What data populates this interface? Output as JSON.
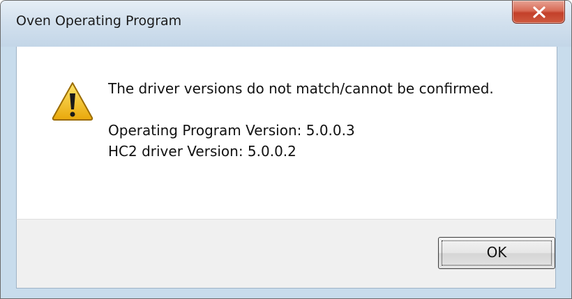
{
  "window": {
    "title": "Oven Operating Program"
  },
  "message": {
    "headline": "The driver versions do not match/cannot be confirmed.",
    "lines": [
      "Operating Program Version: 5.0.0.3",
      "HC2 driver Version: 5.0.0.2"
    ]
  },
  "buttons": {
    "ok_label": "OK",
    "close_icon": "close-icon"
  },
  "icons": {
    "message_icon": "warning-icon"
  },
  "colors": {
    "title_bar": "#c8dcec",
    "close_button": "#cf4f36",
    "warning_fill": "#f3c21c",
    "footer_bg": "#f0f0f0"
  }
}
